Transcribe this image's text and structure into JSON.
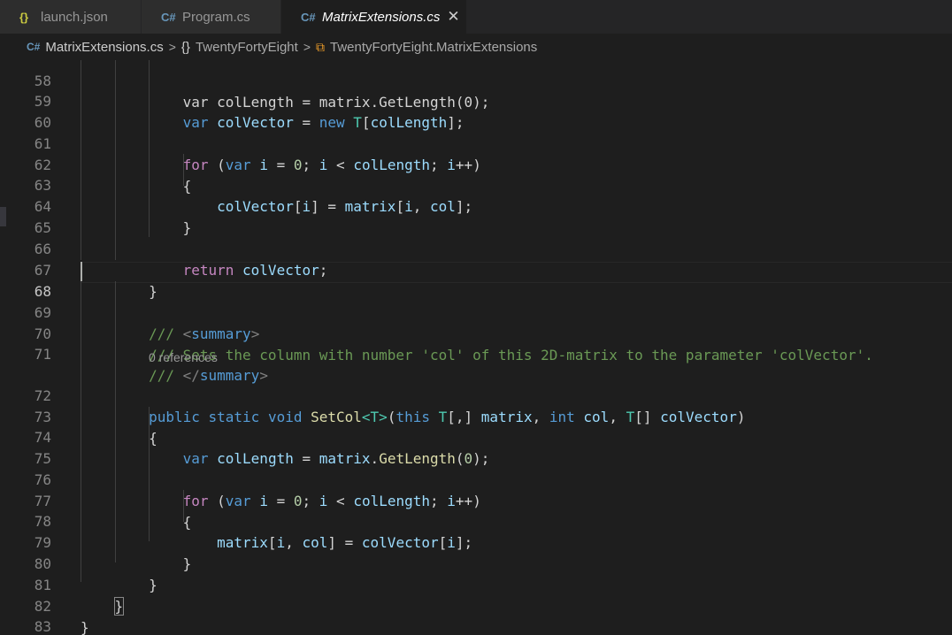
{
  "tabs": [
    {
      "label": "launch.json",
      "icon": "json-braces-icon",
      "active": false
    },
    {
      "label": "Program.cs",
      "icon": "csharp-file-icon",
      "active": false
    },
    {
      "label": "MatrixExtensions.cs",
      "icon": "csharp-file-icon",
      "active": true,
      "close": "✕"
    }
  ],
  "breadcrumb": {
    "file": "MatrixExtensions.cs",
    "namespace": "TwentyFortyEight",
    "class": "TwentyFortyEight.MatrixExtensions",
    "separator": ">"
  },
  "codelens": "0 references",
  "code": [
    {
      "n": "58",
      "text": "            var colLength = matrix.GetLength(0);"
    },
    {
      "n": "59",
      "text": "            var colVector = new T[colLength];"
    },
    {
      "n": "60",
      "text": ""
    },
    {
      "n": "61",
      "text": "            for (var i = 0; i < colLength; i++)"
    },
    {
      "n": "62",
      "text": "            {"
    },
    {
      "n": "63",
      "text": "                colVector[i] = matrix[i, col];"
    },
    {
      "n": "64",
      "text": "            }"
    },
    {
      "n": "65",
      "text": ""
    },
    {
      "n": "66",
      "text": "            return colVector;"
    },
    {
      "n": "67",
      "text": "        }"
    },
    {
      "n": "68",
      "text": ""
    },
    {
      "n": "69",
      "text": "        /// <summary>"
    },
    {
      "n": "70",
      "text": "        /// Sets the column with number 'col' of this 2D-matrix to the parameter 'colVector'."
    },
    {
      "n": "71",
      "text": "        /// </summary>"
    },
    {
      "n": "72",
      "text": "        public static void SetCol<T>(this T[,] matrix, int col, T[] colVector)"
    },
    {
      "n": "73",
      "text": "        {"
    },
    {
      "n": "74",
      "text": "            var colLength = matrix.GetLength(0);"
    },
    {
      "n": "75",
      "text": ""
    },
    {
      "n": "76",
      "text": "            for (var i = 0; i < colLength; i++)"
    },
    {
      "n": "77",
      "text": "            {"
    },
    {
      "n": "78",
      "text": "                matrix[i, col] = colVector[i];"
    },
    {
      "n": "79",
      "text": "            }"
    },
    {
      "n": "80",
      "text": "        }"
    },
    {
      "n": "81",
      "text": "    }"
    },
    {
      "n": "82",
      "text": "}"
    },
    {
      "n": "83",
      "text": ""
    }
  ],
  "colors": {
    "accent": "#ffffff",
    "editor_bg": "#1e1e1e",
    "keyword": "#569cd6",
    "type": "#4ec9b0",
    "comment": "#6a9955"
  }
}
